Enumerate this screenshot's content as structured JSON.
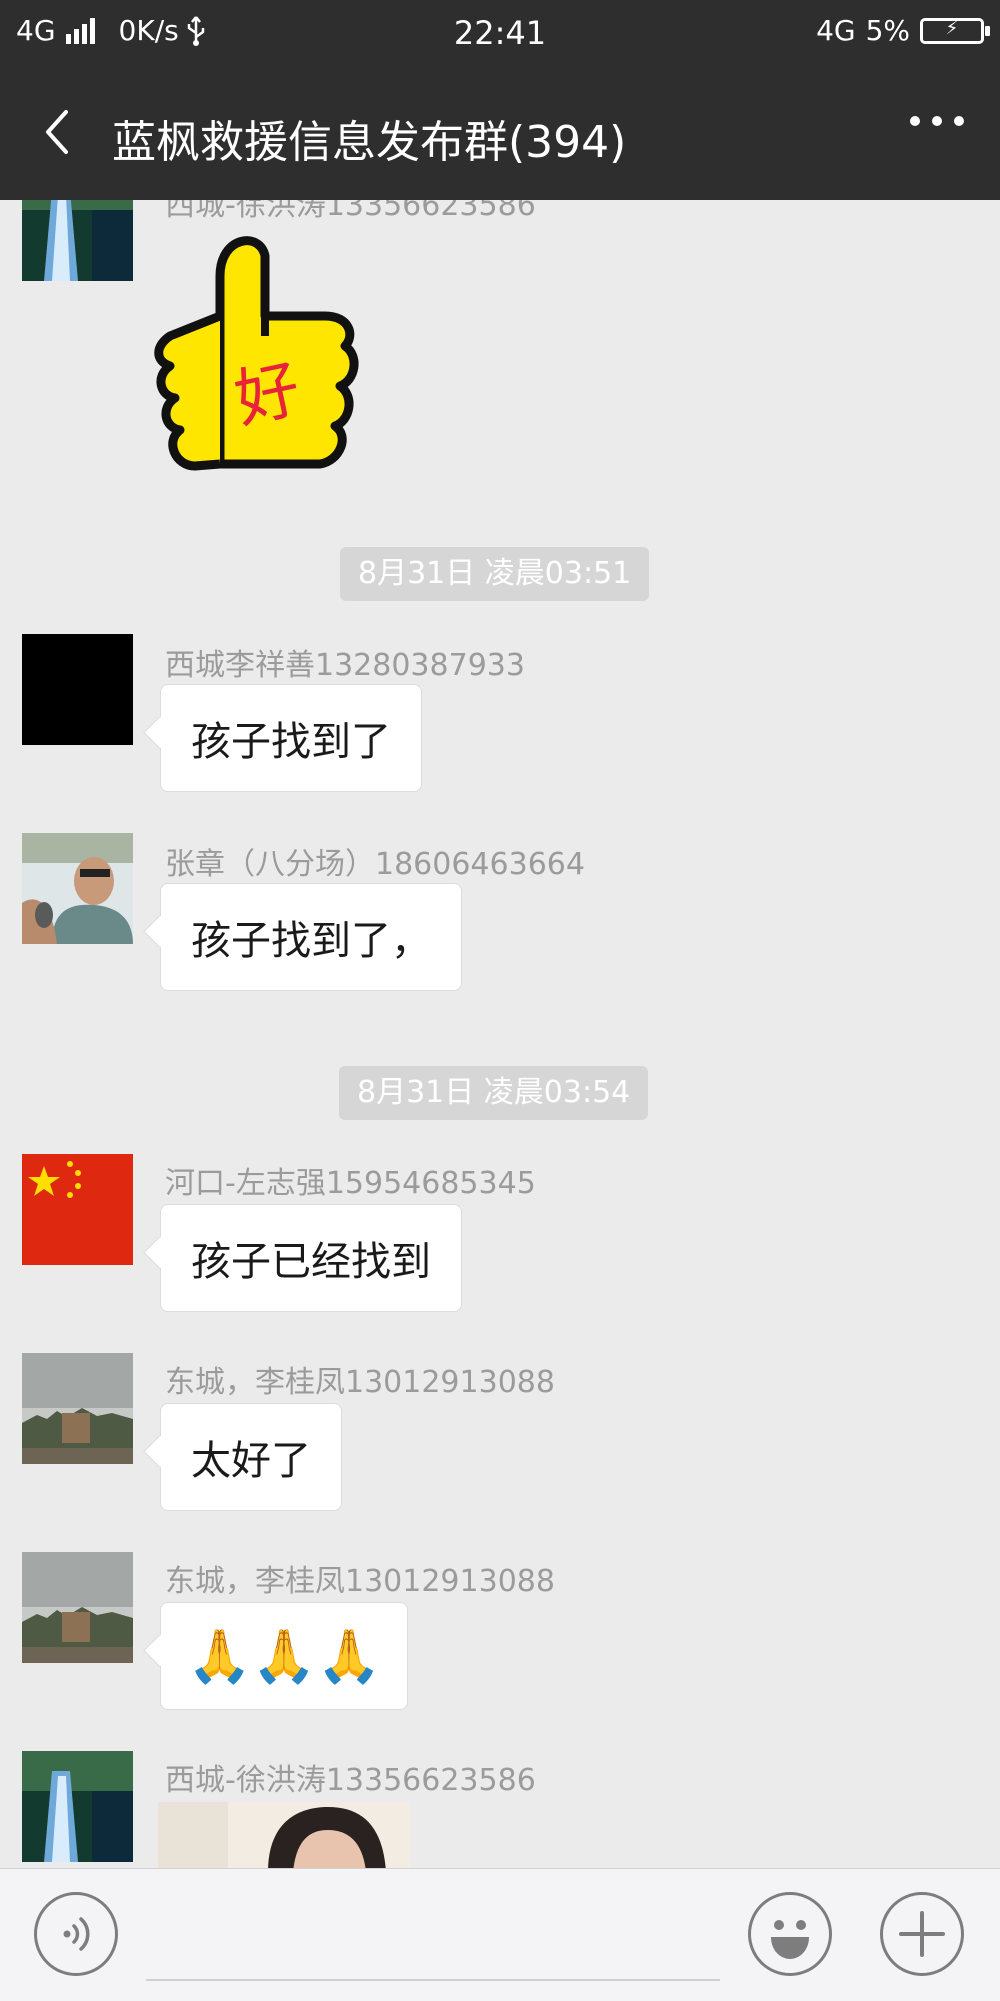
{
  "status_bar": {
    "network_left": "4G",
    "speed": "0K/s",
    "usb_icon": "usb-icon",
    "time": "22:41",
    "network_right": "4G",
    "battery": "5%",
    "battery_icon": "battery-charging-icon"
  },
  "nav": {
    "title": "蓝枫救援信息发布群(394)",
    "back_icon": "back-chevron-icon",
    "more_icon": "more-dots-icon"
  },
  "messages": [
    {
      "type": "sticker",
      "sender": "西城-徐洪涛13356623586",
      "sticker": "thumbs-up-好",
      "sticker_text": "好"
    },
    {
      "type": "time",
      "text": "8月31日 凌晨03:51"
    },
    {
      "type": "text",
      "sender": "西城李祥善13280387933",
      "text": "孩子找到了"
    },
    {
      "type": "text",
      "sender": "张章（八分场）18606463664",
      "text": "孩子找到了，"
    },
    {
      "type": "time",
      "text": "8月31日 凌晨03:54"
    },
    {
      "type": "text",
      "sender": "河口-左志强15954685345",
      "text": "孩子已经找到"
    },
    {
      "type": "text",
      "sender": "东城，李桂凤13012913088",
      "text": "太好了"
    },
    {
      "type": "emoji",
      "sender": "东城，李桂凤13012913088",
      "text": "🙏🙏🙏"
    },
    {
      "type": "image",
      "sender": "西城-徐洪涛13356623586"
    }
  ],
  "input_bar": {
    "voice_icon": "voice-icon",
    "emoji_icon": "emoji-smile-icon",
    "plus_icon": "plus-icon"
  },
  "colors": {
    "header_bg": "#2e2e2e",
    "chat_bg": "#ebebeb",
    "bubble_bg": "#ffffff",
    "timestamp_bg": "#d6d6d6",
    "sender_text": "#9b9b9b"
  }
}
